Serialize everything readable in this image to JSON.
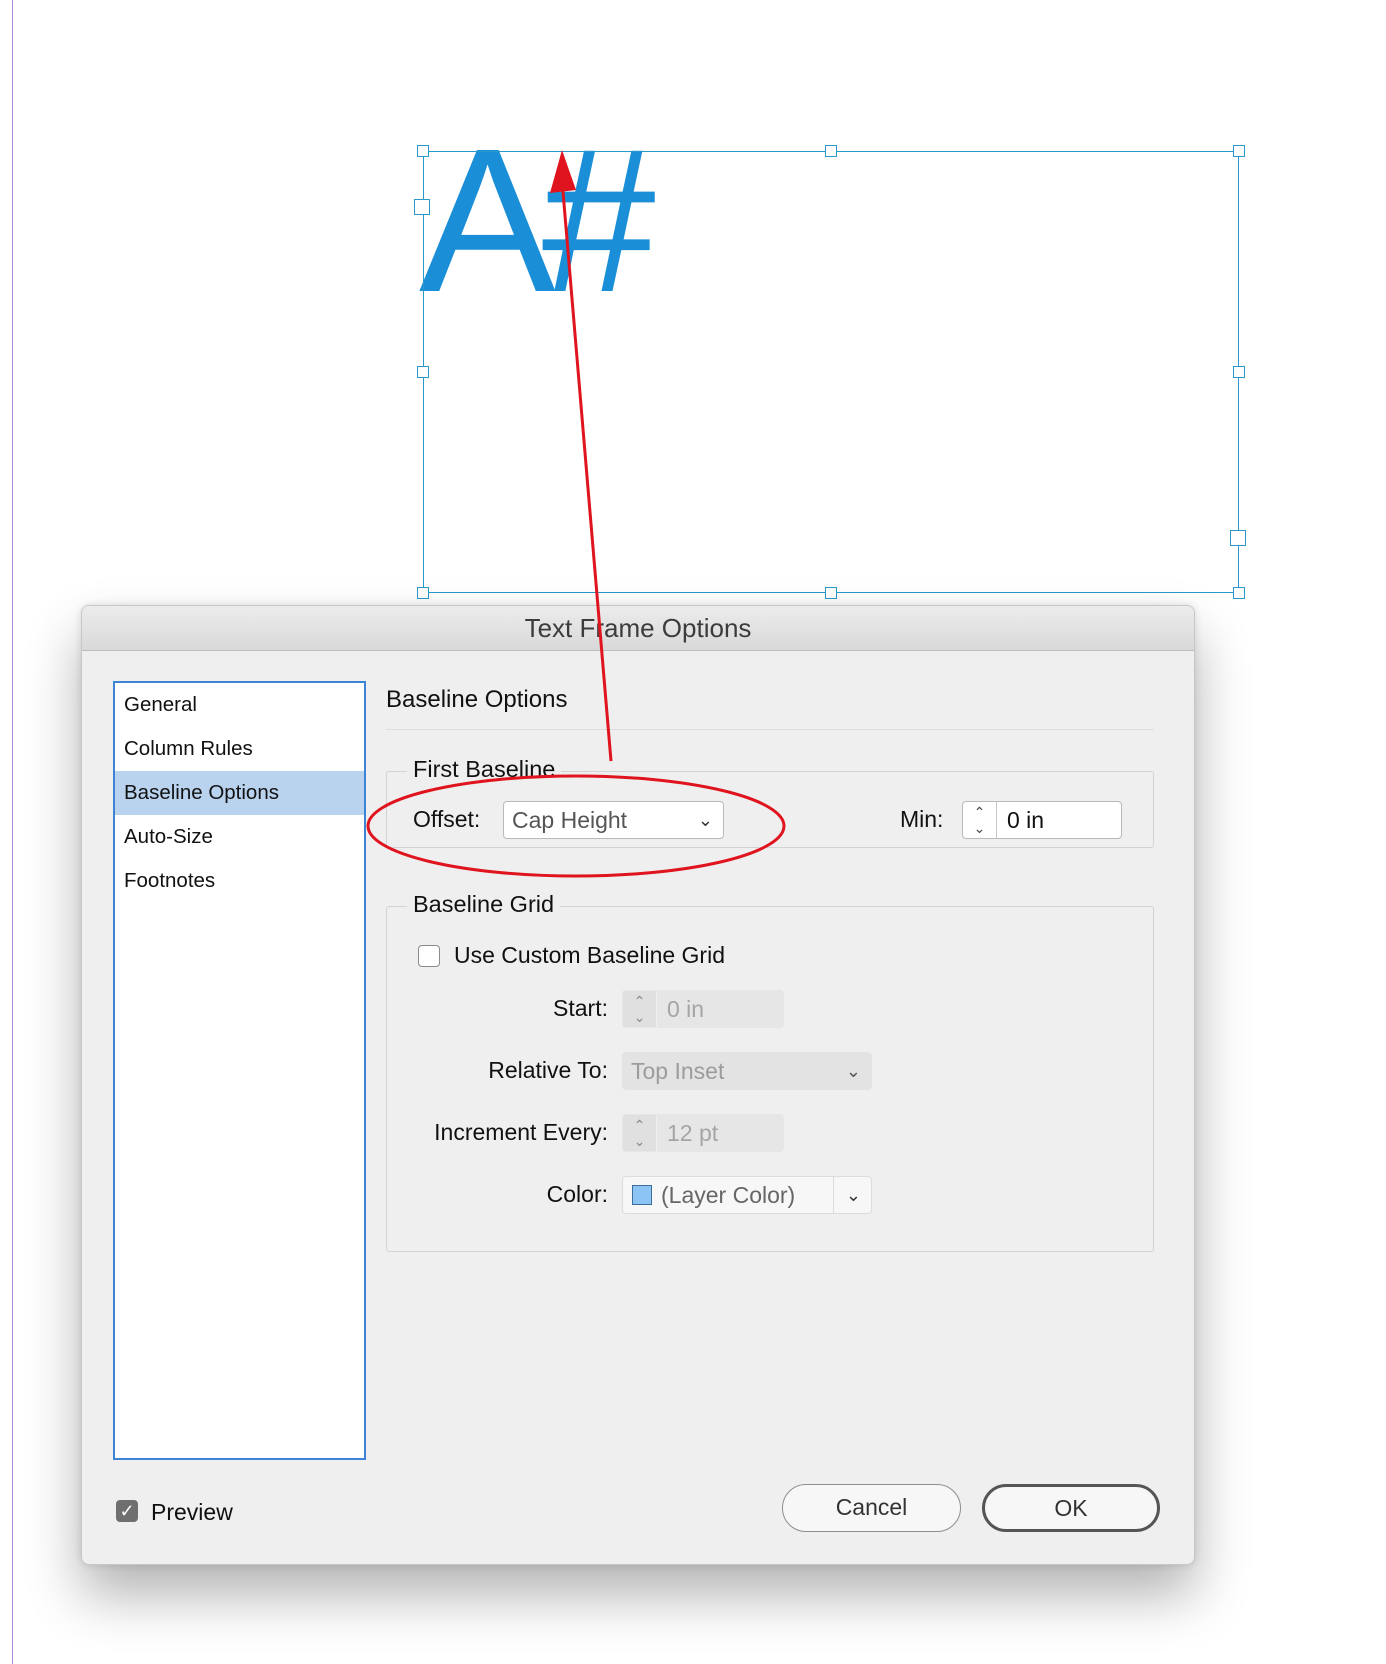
{
  "canvas": {
    "frame_text": "A#"
  },
  "dialog": {
    "title": "Text Frame Options",
    "sidebar": {
      "items": [
        {
          "label": "General"
        },
        {
          "label": "Column Rules"
        },
        {
          "label": "Baseline Options",
          "selected": true
        },
        {
          "label": "Auto-Size"
        },
        {
          "label": "Footnotes"
        }
      ]
    },
    "section_title": "Baseline Options",
    "first_baseline": {
      "group_label": "First Baseline",
      "offset_label": "Offset:",
      "offset_value": "Cap Height",
      "min_label": "Min:",
      "min_value": "0 in"
    },
    "baseline_grid": {
      "group_label": "Baseline Grid",
      "use_custom_label": "Use Custom Baseline Grid",
      "use_custom_checked": false,
      "start_label": "Start:",
      "start_value": "0 in",
      "relative_to_label": "Relative To:",
      "relative_to_value": "Top Inset",
      "increment_label": "Increment Every:",
      "increment_value": "12 pt",
      "color_label": "Color:",
      "color_value": "(Layer Color)"
    },
    "preview_label": "Preview",
    "preview_checked": true,
    "cancel_label": "Cancel",
    "ok_label": "OK"
  },
  "colors": {
    "frame_text": "#1a8fd8",
    "frame_border": "#2a98c8",
    "selection": "#b9d3ef",
    "annotation": "#e0141e",
    "layer_color_swatch": "#8cc4f5"
  }
}
